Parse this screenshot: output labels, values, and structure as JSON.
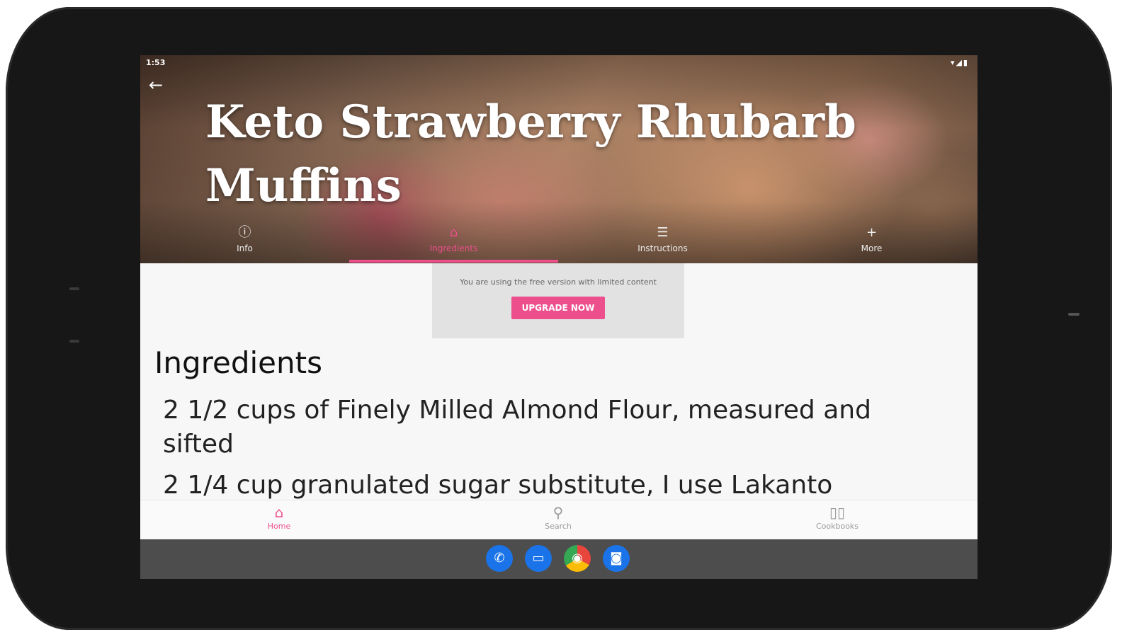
{
  "status_bar": {
    "time": "1:53",
    "icons": "▾◢▮"
  },
  "recipe": {
    "title": "Keto Strawberry Rhubarb Muffins"
  },
  "tabs": [
    {
      "label": "Info",
      "icon": "info-icon",
      "glyph": "ⓘ"
    },
    {
      "label": "Ingredients",
      "icon": "ingredients-icon",
      "glyph": "⌂"
    },
    {
      "label": "Instructions",
      "icon": "list-icon",
      "glyph": "☰"
    },
    {
      "label": "More",
      "icon": "plus-icon",
      "glyph": "+"
    }
  ],
  "colors": {
    "accent": "#ec4f8c"
  },
  "promo": {
    "text": "You are using the free version with limited content",
    "button": "UPGRADE NOW"
  },
  "ingredients": {
    "heading": "Ingredients",
    "items": [
      "2 1/2 cups of Finely Milled Almond Flour, measured and sifted",
      "2 1/4 cup granulated sugar substitute, I use Lakanto"
    ]
  },
  "bottom_nav": [
    {
      "label": "Home",
      "glyph": "⌂"
    },
    {
      "label": "Search",
      "glyph": "⚲"
    },
    {
      "label": "Cookbooks",
      "glyph": "▯▯"
    }
  ],
  "dock": [
    {
      "name": "phone",
      "glyph": "✆",
      "color": "#1a73e8"
    },
    {
      "name": "messages",
      "glyph": "▭",
      "color": "#1a73e8"
    },
    {
      "name": "chrome",
      "glyph": "◉",
      "color": "#e8453c"
    },
    {
      "name": "camera",
      "glyph": "◙",
      "color": "#1a73e8"
    }
  ]
}
